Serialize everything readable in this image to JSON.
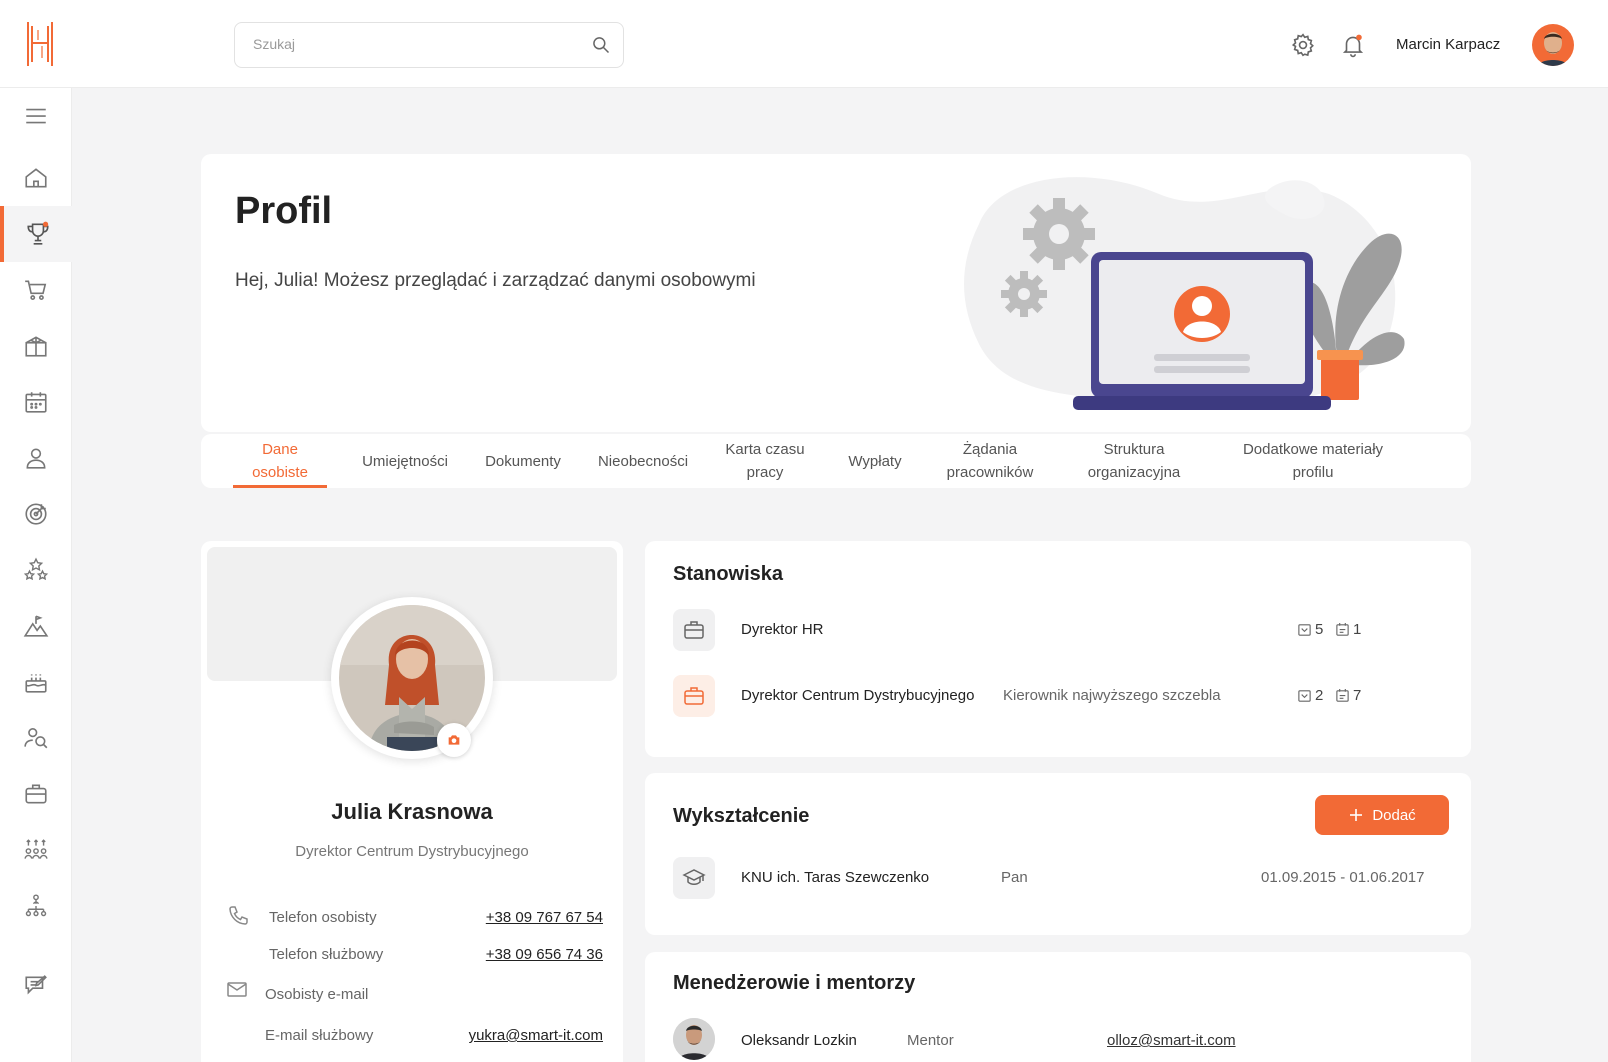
{
  "header": {
    "search_placeholder": "Szukaj",
    "username": "Marcin Karpacz",
    "icons": [
      "hr-logo-icon",
      "search-icon",
      "gear-icon",
      "bell-icon"
    ]
  },
  "sidebar": {
    "items": [
      {
        "name": "menu-icon"
      },
      {
        "name": "home-icon"
      },
      {
        "name": "trophy-icon",
        "active": true
      },
      {
        "name": "cart-icon"
      },
      {
        "name": "gift-icon"
      },
      {
        "name": "calendar-icon"
      },
      {
        "name": "user-icon"
      },
      {
        "name": "target-icon"
      },
      {
        "name": "stars-icon"
      },
      {
        "name": "mountain-flag-icon"
      },
      {
        "name": "cake-icon"
      },
      {
        "name": "user-search-icon"
      },
      {
        "name": "briefcase-icon"
      },
      {
        "name": "team-icon"
      },
      {
        "name": "org-structure-icon"
      },
      {
        "name": "feedback-icon"
      }
    ]
  },
  "hero": {
    "title": "Profil",
    "subtitle": "Hej, Julia! Możesz przeglądać i zarządzać danymi osobowymi"
  },
  "tabs": [
    {
      "label": "Dane\nosobiste",
      "active": true
    },
    {
      "label": "Umiejętności"
    },
    {
      "label": "Dokumenty"
    },
    {
      "label": "Nieobecności"
    },
    {
      "label": "Karta czasu\npracy"
    },
    {
      "label": "Wypłaty"
    },
    {
      "label": "Żądania\npracowników"
    },
    {
      "label": "Struktura\norganizacyjna"
    },
    {
      "label": "Dodatkowe materiały\nprofilu"
    }
  ],
  "profile": {
    "name": "Julia Krasnowa",
    "role": "Dyrektor Centrum Dystrybucyjnego",
    "contacts": [
      {
        "label": "Telefon osobisty",
        "value": "+38 09 767 67 54"
      },
      {
        "label": "Telefon służbowy",
        "value": "+38 09 656 74 36"
      },
      {
        "label": "Osobisty e-mail",
        "value": ""
      },
      {
        "label": "E-mail służbowy",
        "value": "yukra@smart-it.com"
      }
    ]
  },
  "positions": {
    "title": "Stanowiska",
    "items": [
      {
        "name": "Dyrektor HR",
        "level": "",
        "badge_a": "5",
        "badge_b": "1"
      },
      {
        "name": "Dyrektor Centrum Dystrybucyjnego",
        "level": "Kierownik najwyższego szczebla",
        "badge_a": "2",
        "badge_b": "7"
      }
    ]
  },
  "education": {
    "title": "Wykształcenie",
    "add_label": "Dodać",
    "items": [
      {
        "school": "KNU ich. Taras Szewczenko",
        "degree": "Pan",
        "period": "01.09.2015 - 01.06.2017"
      }
    ]
  },
  "managers": {
    "title": "Menedżerowie i mentorzy",
    "items": [
      {
        "name": "Oleksandr Lozkin",
        "role": "Mentor",
        "email": "olloz@smart-it.com"
      }
    ]
  },
  "colors": {
    "accent": "#f26a36",
    "laptop": "#4a468f",
    "background": "#f4f4f5"
  }
}
